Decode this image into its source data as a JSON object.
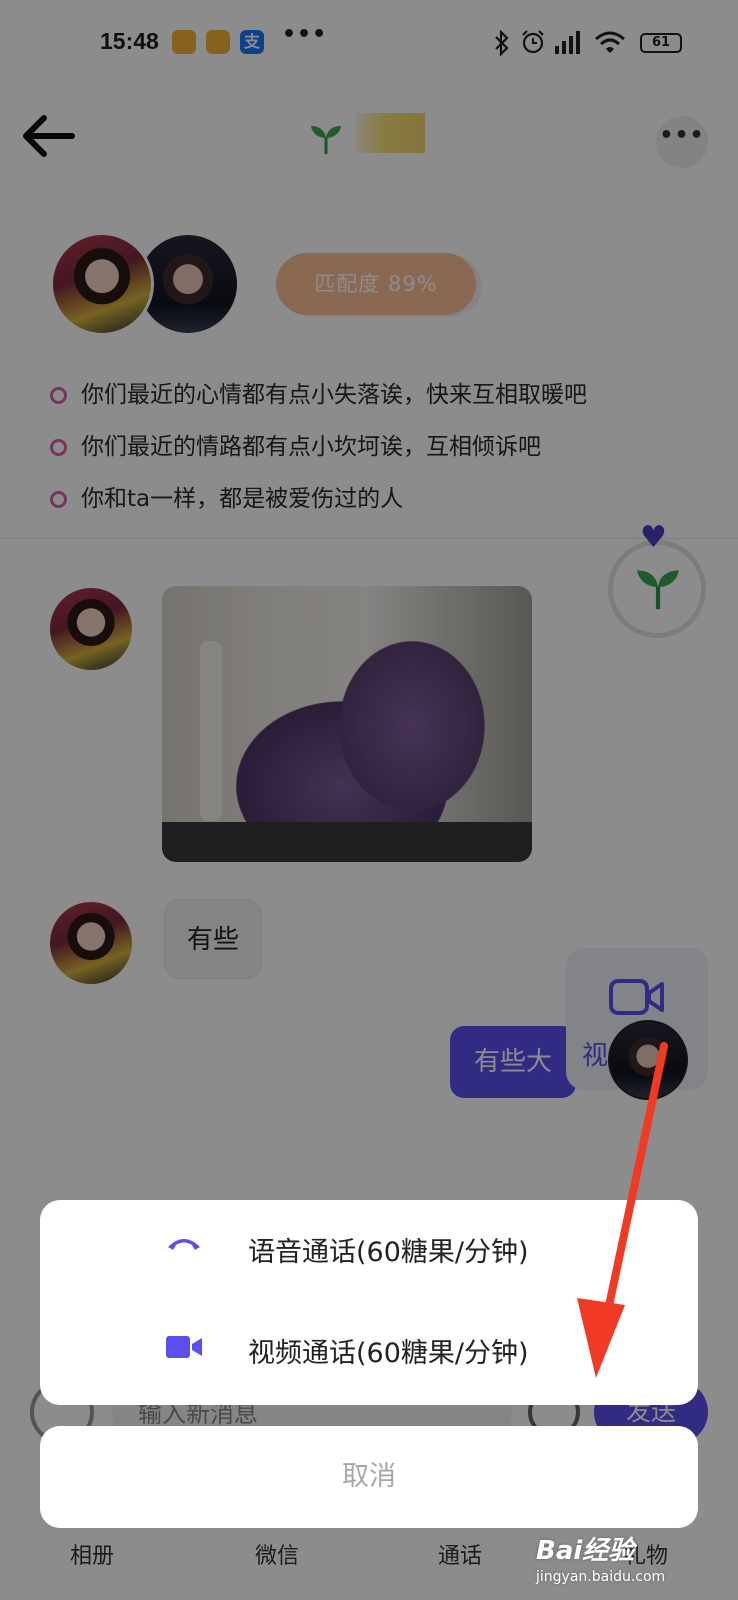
{
  "status_bar": {
    "time": "15:48",
    "dots": "•••",
    "battery": "61",
    "alipay_glyph": "支"
  },
  "header": {
    "back_icon": "back-arrow-icon",
    "title_icon": "sprout-icon",
    "more_label": "•••"
  },
  "match": {
    "score_label": "匹配度 89%"
  },
  "hints": [
    "你们最近的心情都有点小失落诶，快来互相取暖吧",
    "你们最近的情路都有点小坎坷诶，互相倾诉吧",
    "你和ta一样，都是被爱伤过的人"
  ],
  "messages": {
    "incoming_text": "有些",
    "outgoing_text": "有些大"
  },
  "video_fab": {
    "label": "视频聊天",
    "icon": "video-camera-icon"
  },
  "input": {
    "placeholder": "输入新消息",
    "send_label": "发送"
  },
  "bottom_tabs": [
    "相册",
    "微信",
    "通话",
    "礼物"
  ],
  "call_sheet": {
    "voice_label": "语音通话(60糖果/分钟)",
    "video_label": "视频通话(60糖果/分钟)",
    "cancel_label": "取消",
    "voice_icon": "phone-icon",
    "video_icon": "video-camera-icon"
  },
  "watermark": {
    "brand": "Bai经验",
    "url": "jingyan.baidu.com"
  },
  "colors": {
    "accent": "#5b4ff0",
    "match_pill": "#fbbf98",
    "bullet": "#d55fb6",
    "annotation_arrow": "#f03a24"
  }
}
